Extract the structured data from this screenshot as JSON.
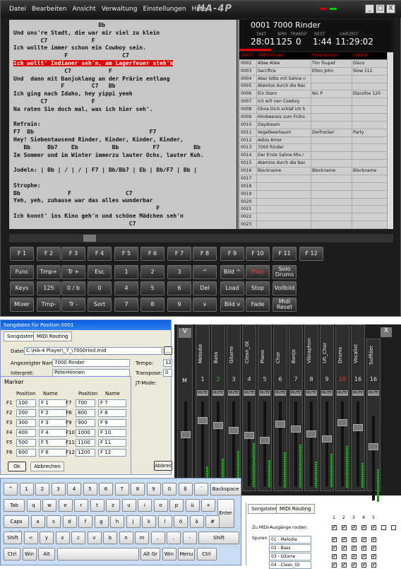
{
  "menu": [
    "Datei",
    "Bearbeiten",
    "Ansicht",
    "Verwaltung",
    "Einstellungen",
    "Hilfe"
  ],
  "app": {
    "logo": "HA-4P",
    "win_buttons": [
      "_",
      "□",
      "X"
    ]
  },
  "lyrics": [
    {
      "t": "                         Bb",
      "hl": false
    },
    {
      "t": "Und uns're Stadt, die war mir viel zu klein",
      "hl": false
    },
    {
      "t": "        C7             F",
      "hl": false
    },
    {
      "t": "Ich wollte immer schon ein Cowboy sein.",
      "hl": false
    },
    {
      "t": "               F                C7",
      "hl": false
    },
    {
      "t": "Ich wollt' Indianer seh'n, am Lagerfeuer steh'n",
      "hl": true
    },
    {
      "t": "               C7           F",
      "hl": false
    },
    {
      "t": "Und  dann mit Banjoklang an der Prärie entlang",
      "hl": false
    },
    {
      "t": "              F        C7   Bb",
      "hl": false
    },
    {
      "t": "Ich ging nach Idaho, hey yippi yeeh",
      "hl": false
    },
    {
      "t": "        C7             F",
      "hl": false
    },
    {
      "t": "Na raten Sie doch mal, was ich hier seh'.",
      "hl": false
    },
    {
      "t": "",
      "hl": false
    },
    {
      "t": "Refrain:",
      "hl": false
    },
    {
      "t": "F7  Bb                                  F7",
      "hl": false
    },
    {
      "t": "Hey! Siebentausend Rinder, Kinder, Kinder, Kinder,",
      "hl": false
    },
    {
      "t": "   Bb     Bb7    Eb          Bb          F7          Bb",
      "hl": false
    },
    {
      "t": "Im Sommer und im Winter immerzu lauter Ochs, lauter Kuh.",
      "hl": false
    },
    {
      "t": "",
      "hl": false
    },
    {
      "t": "Jodeln: | Bb | / | / | F7 | Bb/Bb7 | Eb | Bb/F7 | Bb |",
      "hl": false
    },
    {
      "t": "",
      "hl": false
    },
    {
      "t": "Strophe:",
      "hl": false
    },
    {
      "t": "Bb              F                C7",
      "hl": false
    },
    {
      "t": "Yeh, yeh, zuhause war das alles wunderbar",
      "hl": false
    },
    {
      "t": "                                          F",
      "hl": false
    },
    {
      "t": "Ich konnt' ins Kino geh'n und schöne Mädchen seh'n",
      "hl": false
    },
    {
      "t": "                                  C7",
      "hl": false
    }
  ],
  "info": {
    "title": "0001 7000 Rinder",
    "labels": [
      "TAKT",
      "BPM",
      "TRANSP",
      "REST",
      "UHRZEIT"
    ],
    "values": [
      "28:01",
      "125",
      "0",
      "1:44",
      "11:29:02"
    ]
  },
  "songs": [
    [
      "0001*",
      "7000 Rinder",
      "PeterHinnen",
      "Foxtrot"
    ],
    [
      "0002",
      "Allee Allee",
      "Tim Toupet",
      "Disco"
    ],
    [
      "0003",
      "Sacrifice",
      "Elton John",
      "Slow 112"
    ],
    [
      "0004",
      "Aber bitte mit Sahne n",
      "",
      ""
    ],
    [
      "0005",
      "Atemlos durch die Nac",
      "",
      ""
    ],
    [
      "0006",
      "Ein Stern",
      "Nic P",
      "Discofox 120"
    ],
    [
      "0007",
      "Ich will nen Cowboy",
      "",
      ""
    ],
    [
      "0008",
      "Ohne Dich schlaf ich h",
      "",
      ""
    ],
    [
      "0009",
      "Himbeereis zum Frühs",
      "",
      ""
    ],
    [
      "0010",
      "Daydream",
      "",
      ""
    ],
    [
      "0011",
      "Vogelbeerbaum",
      "Dorfrocker",
      "Party"
    ],
    [
      "0012",
      "Adios Amor",
      "",
      ""
    ],
    [
      "0013",
      "7000 Rinder",
      "",
      ""
    ],
    [
      "0014",
      "Der Erste Sahne Mix.r",
      "",
      ""
    ],
    [
      "0015",
      "Atemlos durch die Nac",
      "",
      ""
    ],
    [
      "0016",
      "Blockname",
      "Blockname",
      "Blockname"
    ],
    [
      "0017",
      "",
      "",
      ""
    ],
    [
      "0018",
      "",
      "",
      ""
    ],
    [
      "0019",
      "",
      "",
      ""
    ],
    [
      "0020",
      "",
      "",
      ""
    ],
    [
      "0021",
      "",
      "",
      ""
    ],
    [
      "0022",
      "",
      "",
      ""
    ],
    [
      "0023",
      "",
      "",
      ""
    ]
  ],
  "keys": [
    [
      "F 1",
      "F 2",
      "F 3",
      "F 4",
      "F 5",
      "F 6",
      "F 7",
      "F 8",
      "F 9",
      "F 10",
      "F 11",
      "F 12"
    ],
    [
      "Func",
      "Tmp+",
      "Tr +",
      "Esc",
      "1",
      "2",
      "3",
      "^",
      "Bild ^",
      "Play",
      "Solo Drums"
    ],
    [
      "Keys",
      "125",
      "0 / b",
      "0",
      "4",
      "5",
      "6",
      "Del",
      "Load",
      "Stop",
      "Vollbild"
    ],
    [
      "Mixer",
      "Tmp-",
      "Tr -",
      "Sort",
      "7",
      "8",
      "9",
      "v",
      "Bild v",
      "Fade",
      "Midi Reset"
    ]
  ],
  "mixer": {
    "channels": [
      {
        "name": "Melodie",
        "num": "1"
      },
      {
        "name": "Bass",
        "num": "2"
      },
      {
        "name": "Gitarre",
        "num": "3"
      },
      {
        "name": "Clean_Gt",
        "num": "4"
      },
      {
        "name": "Piano",
        "num": "5"
      },
      {
        "name": "Chor",
        "num": "6"
      },
      {
        "name": "Banjo",
        "num": "7"
      },
      {
        "name": "Vibraphon",
        "num": "8"
      },
      {
        "name": "Uh_Chor",
        "num": "9"
      },
      {
        "name": "Drums",
        "num": "10"
      },
      {
        "name": "Vocalist",
        "num": "16"
      },
      {
        "name": "Sufflöer",
        "num": "16"
      }
    ],
    "mute": "MUTE",
    "v_btn": "V",
    "m_lbl": "M",
    "x_btn": "X",
    "dash": "--"
  },
  "songwin": {
    "title": "Songdaten für Position 0001",
    "tabs": [
      "Songdaten",
      "MIDI Routing"
    ],
    "datei_lbl": "Datei:",
    "datei": "C:\\HA-4 Player\\_7_\\7000rind.mid",
    "name_lbl": "Angezeigter Name:",
    "name": "7000 Rinder",
    "tempo_lbl": "Tempo:",
    "tempo": "125",
    "interp_lbl": "Interpret:",
    "interp": "PeterHinnen",
    "transpose_lbl": "Transpose:",
    "transpose": "0",
    "jtmode": "JT-Mode:",
    "browse": "...",
    "abbrechen": "Abbrec"
  },
  "marker": {
    "title": "Marker",
    "col_pos": "Position",
    "col_name": "Name",
    "left": [
      [
        "F1",
        "100",
        "F 1"
      ],
      [
        "F2",
        "200",
        "F 2"
      ],
      [
        "F3",
        "300",
        "F 3"
      ],
      [
        "F4",
        "400",
        "F 4"
      ],
      [
        "F5",
        "500",
        "F 5"
      ],
      [
        "F6",
        "600",
        "F 6"
      ]
    ],
    "right": [
      [
        "F7",
        "700",
        "F 7"
      ],
      [
        "F8",
        "800",
        "F 8"
      ],
      [
        "F9",
        "900",
        "F 9"
      ],
      [
        "F10",
        "1000",
        "F 10"
      ],
      [
        "F11",
        "1100",
        "F 11"
      ],
      [
        "F12",
        "1200",
        "F 12"
      ]
    ],
    "ok": "Ok",
    "cancel": "Abbrechen"
  },
  "osk": {
    "rows": [
      [
        "^",
        "1",
        "2",
        "3",
        "4",
        "5",
        "6",
        "7",
        "8",
        "9",
        "0",
        "ß",
        "´",
        "Backspace"
      ],
      [
        "Tab",
        "q",
        "w",
        "e",
        "r",
        "t",
        "z",
        "u",
        "i",
        "o",
        "p",
        "ü",
        "+",
        "Enter"
      ],
      [
        "Caps Lock",
        "a",
        "s",
        "d",
        "f",
        "g",
        "h",
        "j",
        "k",
        "l",
        "ö",
        "ä",
        "#"
      ],
      [
        "Shift",
        "<",
        "y",
        "x",
        "c",
        "v",
        "b",
        "n",
        "m",
        ",",
        ".",
        "-",
        "Shift"
      ],
      [
        "Ctrl",
        "Win",
        "Alt",
        "",
        "Alt Gr",
        "Win",
        "Menu",
        "Ctrl"
      ]
    ],
    "alt": {
      "2": "\"",
      "3": "§",
      "q": "@",
      "e": "€",
      "+": "*",
      "<": ">",
      "m": "µ"
    }
  },
  "midiwin": {
    "tabs": [
      "Songdaten",
      "MIDI Routing"
    ],
    "outputs_lbl": "Zu MIDI-Ausgänge routen:",
    "nums": [
      "1",
      "2",
      "3",
      "4",
      "5"
    ],
    "spuren": "Spuren",
    "tracks": [
      "01 - Melodie",
      "02 - Bass",
      "03 - Gitarre",
      "04 - Clean_Gt"
    ]
  }
}
